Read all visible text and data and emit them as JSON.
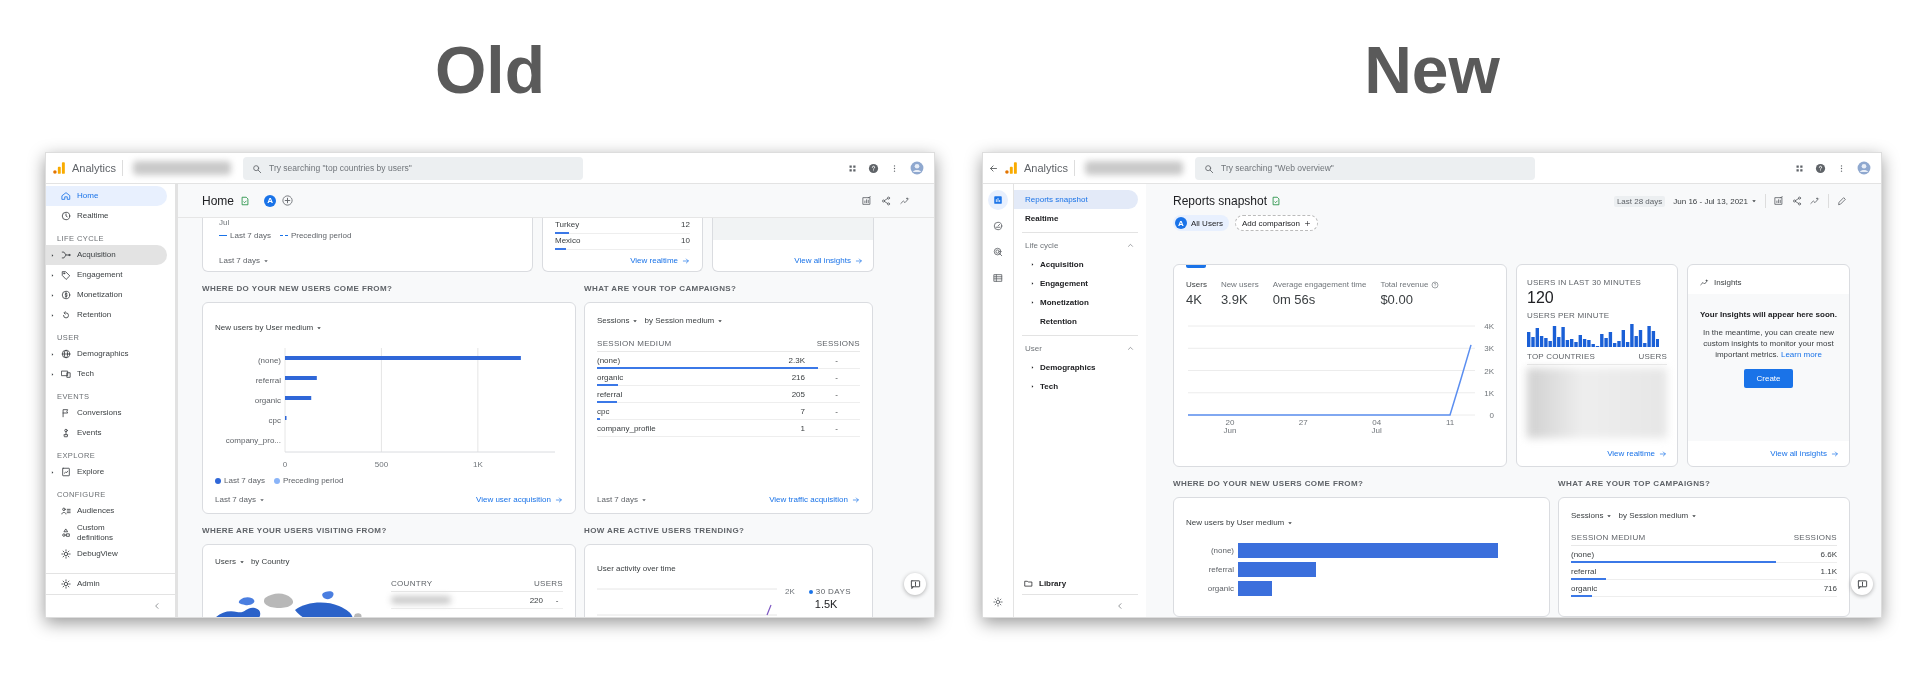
{
  "old": {
    "heading": "Old",
    "topbar": {
      "app_name": "Analytics",
      "search_placeholder": "Try searching \"top countries by users\""
    },
    "sidebar": {
      "sections": [
        {
          "items": [
            {
              "label": "Home",
              "selected": true,
              "hovered": false,
              "expandable": false
            },
            {
              "label": "Realtime",
              "selected": false,
              "hovered": false,
              "expandable": false
            }
          ]
        },
        {
          "title": "LIFE CYCLE",
          "items": [
            {
              "label": "Acquisition",
              "selected": false,
              "hovered": true,
              "expandable": true
            },
            {
              "label": "Engagement",
              "selected": false,
              "hovered": false,
              "expandable": true
            },
            {
              "label": "Monetization",
              "selected": false,
              "hovered": false,
              "expandable": true
            },
            {
              "label": "Retention",
              "selected": false,
              "hovered": false,
              "expandable": true
            }
          ]
        },
        {
          "title": "USER",
          "items": [
            {
              "label": "Demographics",
              "selected": false,
              "hovered": false,
              "expandable": true
            },
            {
              "label": "Tech",
              "selected": false,
              "hovered": false,
              "expandable": true
            }
          ]
        },
        {
          "title": "EVENTS",
          "items": [
            {
              "label": "Conversions",
              "selected": false,
              "hovered": false,
              "expandable": false
            },
            {
              "label": "Events",
              "selected": false,
              "hovered": false,
              "expandable": false
            }
          ]
        },
        {
          "title": "EXPLORE",
          "items": [
            {
              "label": "Explore",
              "selected": false,
              "hovered": false,
              "expandable": true
            }
          ]
        },
        {
          "title": "CONFIGURE",
          "items": [
            {
              "label": "Audiences",
              "selected": false,
              "hovered": false,
              "expandable": false
            },
            {
              "label": "Custom definitions",
              "selected": false,
              "hovered": false,
              "expandable": false
            },
            {
              "label": "DebugView",
              "selected": false,
              "hovered": false,
              "expandable": false
            }
          ]
        }
      ],
      "footer_item": {
        "label": "Admin",
        "selected": false,
        "hovered": false
      }
    },
    "page_title": "Home",
    "segment_avatar": "A",
    "overview_cards": {
      "trend": {
        "axis_label": "Jul",
        "legend": [
          {
            "label": "Last 7 days",
            "kind": "solid"
          },
          {
            "label": "Preceding period",
            "kind": "dashed"
          }
        ],
        "range": "Last 7 days"
      },
      "realtime": {
        "rows": [
          {
            "country": "Turkey",
            "users": "12",
            "level": 0.1
          },
          {
            "country": "Mexico",
            "users": "10",
            "level": 0.08
          }
        ],
        "link": "View realtime"
      },
      "insights": {
        "link": "View all insights"
      }
    },
    "new_users": {
      "heading": "WHERE DO YOUR NEW USERS COME FROM?",
      "dropdown": "New users by User medium",
      "chart_data": {
        "type": "bar",
        "orientation": "horizontal",
        "categories": [
          "(none)",
          "referral",
          "organic",
          "cpc",
          "company_pro..."
        ],
        "series": [
          {
            "name": "Last 7 days",
            "color": "#2f67d8",
            "values": [
              1223,
              165,
              136,
              5,
              0
            ]
          },
          {
            "name": "Preceding period",
            "color": "#8ab4f8",
            "values": [
              null,
              null,
              null,
              null,
              null
            ]
          }
        ],
        "xlim": [
          0,
          1400
        ],
        "grid": true,
        "xticks": [
          0,
          500,
          {
            "value": 1000,
            "label": "1K"
          }
        ]
      },
      "range": "Last 7 days",
      "link": "View user acquisition"
    },
    "campaigns": {
      "heading": "WHAT ARE YOUR TOP CAMPAIGNS?",
      "metric": "Sessions",
      "dimension": "by Session medium",
      "columns": [
        "SESSION MEDIUM",
        "SESSIONS"
      ],
      "rows": [
        {
          "medium": "(none)",
          "column_2": "2.3K",
          "column_3": "-",
          "level": 0.84
        },
        {
          "medium": "organic",
          "column_2": "216",
          "column_3": "-",
          "level": 0.08
        },
        {
          "medium": "referral",
          "column_2": "205",
          "column_3": "-",
          "level": 0.077
        },
        {
          "medium": "cpc",
          "column_2": "7",
          "column_3": "-",
          "level": 0.004
        },
        {
          "medium": "company_profile",
          "column_2": "1",
          "column_3": "-"
        }
      ],
      "range": "Last 7 days",
      "link": "View traffic acquisition"
    },
    "countries": {
      "heading": "WHERE ARE YOUR USERS VISITING FROM?",
      "metric": "Users",
      "dimension": "by Country",
      "columns": [
        "COUNTRY",
        "USERS"
      ],
      "rows": [
        {
          "column_2": "220",
          "column_3": "-"
        }
      ]
    },
    "trend": {
      "heading": "HOW ARE ACTIVE USERS TRENDING?",
      "title": "User activity over time",
      "tick": "2K",
      "legend": "30 DAYS",
      "value": "1.5K"
    }
  },
  "new": {
    "heading": "New",
    "topbar": {
      "app_name": "Analytics",
      "search_placeholder": "Try searching \"Web overview\""
    },
    "rail": [
      {
        "selected": true
      },
      {
        "selected": false
      },
      {
        "selected": false
      },
      {
        "selected": false
      }
    ],
    "nav": {
      "items": [
        {
          "label": "Reports snapshot",
          "selected": true
        },
        {
          "label": "Realtime",
          "selected": false
        }
      ],
      "sections": [
        {
          "title": "Life cycle",
          "expanded": true,
          "items": [
            {
              "label": "Acquisition",
              "expandable": true
            },
            {
              "label": "Engagement",
              "expandable": true
            },
            {
              "label": "Monetization",
              "expandable": true
            },
            {
              "label": "Retention",
              "expandable": false
            }
          ]
        },
        {
          "title": "User",
          "expanded": true,
          "items": [
            {
              "label": "Demographics",
              "expandable": true
            },
            {
              "label": "Tech",
              "expandable": true
            }
          ]
        }
      ],
      "library": "Library"
    },
    "page_title": "Reports snapshot",
    "comparison": {
      "avatar": "A",
      "segment": "All Users",
      "add": "Add comparison"
    },
    "date": {
      "preset": "Last 28 days",
      "range": "Jun 16 - Jul 13, 2021"
    },
    "metrics": [
      {
        "label": "Users",
        "value": "4K",
        "selected": true,
        "info": false
      },
      {
        "label": "New users",
        "value": "3.9K",
        "selected": false,
        "info": false
      },
      {
        "label": "Average engagement time",
        "value": "0m 56s",
        "selected": false,
        "info": false
      },
      {
        "label": "Total revenue",
        "value": "$0.00",
        "selected": false,
        "info": true
      }
    ],
    "users_chart": {
      "chart_data": {
        "type": "line",
        "categories": [
          null,
          null,
          null,
          null,
          "20 Jun",
          null,
          null,
          null,
          null,
          null,
          null,
          "27",
          null,
          null,
          null,
          null,
          null,
          null,
          "04 Jul",
          null,
          null,
          null,
          null,
          null,
          null,
          "11",
          null,
          null
        ],
        "series": [
          {
            "color": "#5b8ef0",
            "values": [
              0,
              0,
              0,
              0,
              0,
              0,
              0,
              0,
              0,
              0,
              0,
              0,
              0,
              0,
              0,
              0,
              0,
              0,
              0,
              0,
              0,
              0,
              0,
              0,
              0,
              0,
              1550,
              3150
            ]
          }
        ],
        "ylim": [
          0,
          4000
        ],
        "grid": true,
        "yticks": [
          {
            "value": 0,
            "label": "0"
          },
          {
            "value": 1000,
            "label": "1K"
          },
          {
            "value": 2000,
            "label": "2K"
          },
          {
            "value": 3000,
            "label": "3K"
          },
          {
            "value": 4000,
            "label": "4K"
          }
        ]
      }
    },
    "realtime": {
      "title": "USERS IN LAST 30 MINUTES",
      "value": "120",
      "subtitle": "USERS PER MINUTE",
      "columns": [
        "TOP COUNTRIES",
        "USERS"
      ],
      "link": "View realtime"
    },
    "insights": {
      "title": "Insights",
      "headline": "Your Insights will appear here soon.",
      "body": "In the meantime, you can create new custom insights to monitor your most important metrics.",
      "link_text": "Learn more",
      "button": "Create",
      "footer_link": "View all insights"
    },
    "new_users": {
      "heading": "WHERE DO YOUR NEW USERS COME FROM?",
      "dropdown": "New users by User medium",
      "categories": [
        "(none)",
        "referral",
        "organic"
      ]
    },
    "campaigns": {
      "heading": "WHAT ARE YOUR TOP CAMPAIGNS?",
      "metric": "Sessions",
      "dimension": "by Session medium",
      "columns": [
        "SESSION MEDIUM",
        "SESSIONS"
      ],
      "rows": [
        {
          "medium": "(none)",
          "sessions": "6.6K",
          "level": 0.77
        },
        {
          "medium": "referral",
          "sessions": "1.1K",
          "level": 0.13
        },
        {
          "medium": "organic",
          "sessions": "716",
          "level": 0.08
        }
      ]
    }
  }
}
